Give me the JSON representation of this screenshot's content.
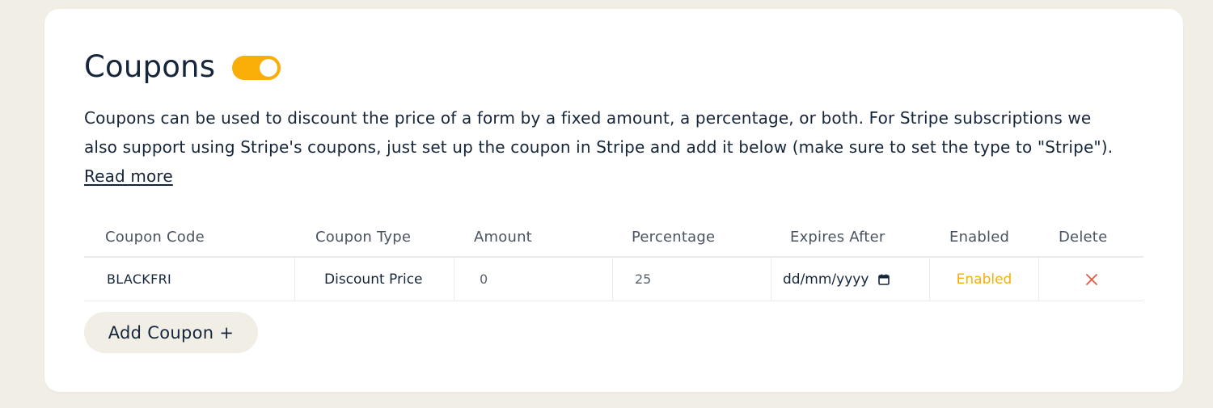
{
  "section": {
    "title": "Coupons",
    "toggle_on": true,
    "description": "Coupons can be used to discount the price of a form by a fixed amount, a percentage, or both. For Stripe subscriptions we also support using Stripe's coupons, just set up the coupon in Stripe and add it below (make sure to set the type to \"Stripe\"). ",
    "read_more": "Read more"
  },
  "table": {
    "headers": {
      "code": "Coupon Code",
      "type": "Coupon Type",
      "amount": "Amount",
      "percentage": "Percentage",
      "expires": "Expires After",
      "enabled": "Enabled",
      "delete": "Delete"
    },
    "rows": [
      {
        "code": "BLACKFRI",
        "type": "Discount Price",
        "amount": "0",
        "percentage": "25",
        "expires_placeholder": "dd/mm/yyyy",
        "enabled": "Enabled"
      }
    ]
  },
  "add_button": "Add Coupon +",
  "colors": {
    "accent": "#f9ad07",
    "delete": "#e0573f",
    "background": "#f1eee6",
    "text": "#15253a"
  },
  "icons": {
    "calendar": "calendar-icon",
    "delete": "close-icon"
  }
}
